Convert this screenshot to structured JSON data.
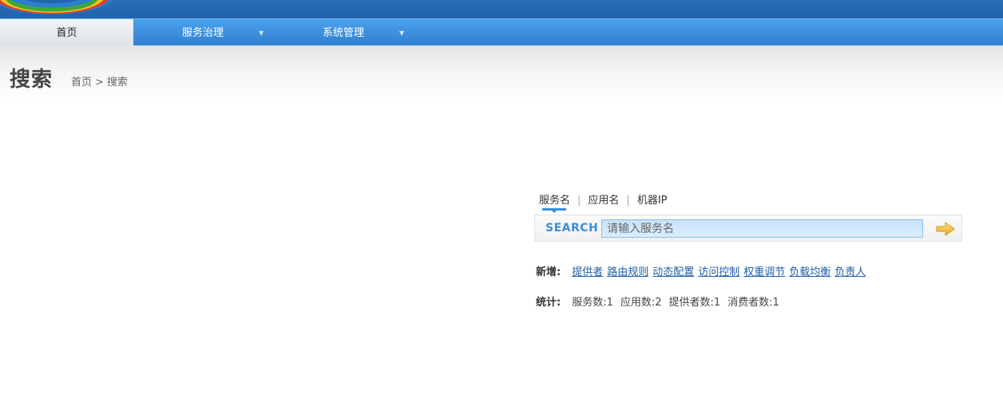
{
  "nav": {
    "home": "首页",
    "service_governance": "服务治理",
    "system_management": "系统管理",
    "dropdown_arrow": "▼"
  },
  "header": {
    "title": "搜索",
    "breadcrumb": {
      "home": "首页",
      "separator": ">",
      "current": "搜索"
    }
  },
  "search": {
    "tabs": [
      "服务名",
      "应用名",
      "机器IP"
    ],
    "separator": "|",
    "active_tab": 0,
    "label": "SEARCH",
    "placeholder": "请输入服务名",
    "value": ""
  },
  "add_links": {
    "label": "新增:",
    "items": [
      "提供者",
      "路由规则",
      "动态配置",
      "访问控制",
      "权重调节",
      "负载均衡",
      "负责人"
    ]
  },
  "stats": {
    "label": "统计:",
    "items": [
      "服务数:1",
      "应用数:2",
      "提供者数:1",
      "消费者数:1"
    ]
  },
  "icons": {
    "logo": "logo-icon",
    "go": "arrow-right-icon"
  },
  "colors": {
    "top_banner": "#2262ac",
    "nav_bar": "#3e92e0",
    "link": "#1f5fa8",
    "search_label": "#3b8fd6",
    "go_arrow": "#f5b731"
  }
}
